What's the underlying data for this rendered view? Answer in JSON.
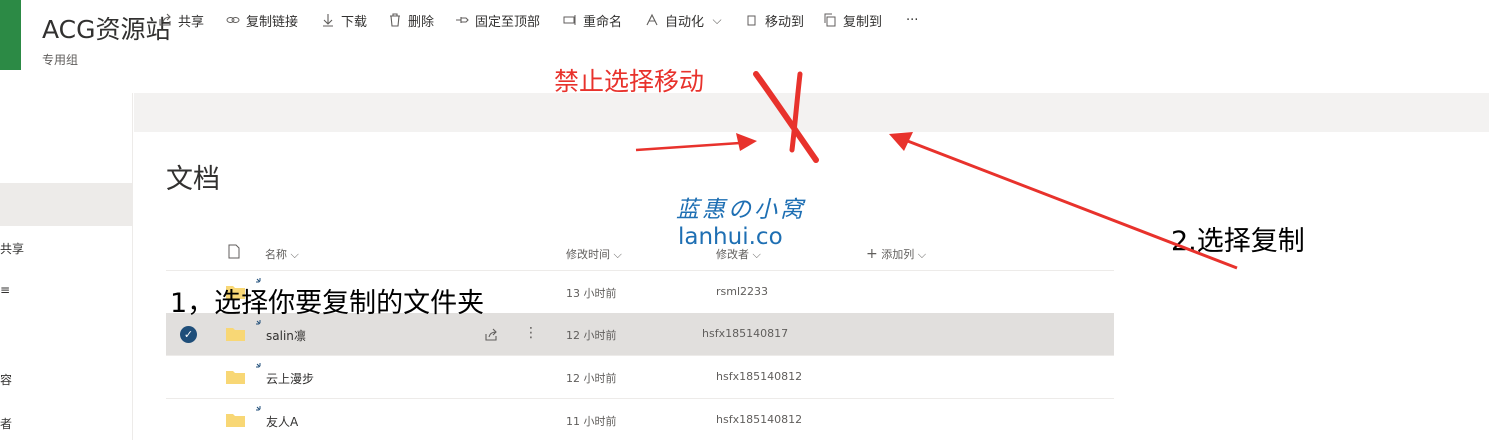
{
  "site": {
    "title": "ACG资源站",
    "subtitle": "专用组",
    "logo_color": "#2c8a45"
  },
  "leftnav": {
    "items": [
      "共享",
      "≡",
      "容",
      "者"
    ]
  },
  "commandbar": {
    "items": [
      {
        "label": "共享",
        "icon": "share-icon"
      },
      {
        "label": "复制链接",
        "icon": "link-icon"
      },
      {
        "label": "下载",
        "icon": "download-icon"
      },
      {
        "label": "删除",
        "icon": "trash-icon"
      },
      {
        "label": "固定至顶部",
        "icon": "pin-icon"
      },
      {
        "label": "重命名",
        "icon": "rename-icon"
      },
      {
        "label": "自动化",
        "icon": "flow-icon"
      },
      {
        "label": "移动到",
        "icon": "move-icon"
      },
      {
        "label": "复制到",
        "icon": "copy-icon"
      }
    ],
    "more": "···"
  },
  "doc_title": "文档",
  "columns": {
    "name": "名称",
    "modified": "修改时间",
    "modified_by": "修改者",
    "add_column": "添加列"
  },
  "rows": [
    {
      "name": "",
      "modified": "13 小时前",
      "modified_by": "rsml2233",
      "selected": false
    },
    {
      "name": "salin凛",
      "modified": "12 小时前",
      "modified_by": "hsfx185140817",
      "selected": true
    },
    {
      "name": "云上漫步",
      "modified": "12 小时前",
      "modified_by": "hsfx185140812",
      "selected": false
    },
    {
      "name": "友人A",
      "modified": "11 小时前",
      "modified_by": "hsfx185140812",
      "selected": false
    }
  ],
  "annotations": {
    "forbid": "禁止选择移动",
    "step1": "1，选择你要复制的文件夹",
    "step2": "2.选择复制"
  },
  "watermark": {
    "cn": "蓝惠の小窝",
    "en": "lanhui.co"
  },
  "colors": {
    "accent": "#1f4e79",
    "annotation_red": "#e8322c",
    "folder": "#f8d775",
    "watermark": "#1e6fb3"
  }
}
